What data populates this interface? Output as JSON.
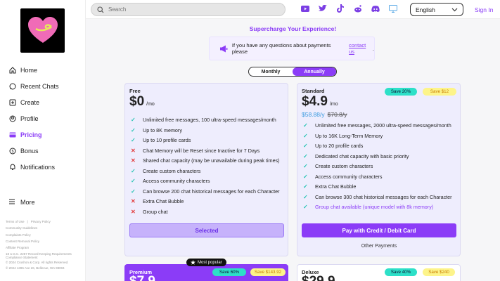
{
  "sidebar": {
    "items": [
      {
        "label": "Home",
        "icon": "home-icon"
      },
      {
        "label": "Recent Chats",
        "icon": "chat-icon"
      },
      {
        "label": "Create",
        "icon": "plus-square-icon"
      },
      {
        "label": "Profile",
        "icon": "user-icon"
      },
      {
        "label": "Pricing",
        "icon": "card-icon",
        "active": true
      },
      {
        "label": "Bonus",
        "icon": "coin-icon"
      },
      {
        "label": "Notifications",
        "icon": "bell-icon"
      }
    ],
    "more_label": "More",
    "footer": {
      "terms": "Terms of Use",
      "privacy": "Privacy Policy",
      "guidelines": "Community Guidelines",
      "complaints": "Complaints Policy",
      "content_removal": "Content Removal Policy",
      "affiliate": "Affiliate Program",
      "usc": "18 U.S.C. 2257 Record-Keeping Requirements Compliance Statement",
      "copyright": "© 2024 Crushon & Corp. All rights Reserved.",
      "address": "© 2024 1396 Ave 26, Bellevue, WA 98004"
    }
  },
  "topbar": {
    "search_placeholder": "Search",
    "socials": [
      "youtube-icon",
      "twitter-icon",
      "tiktok-icon",
      "reddit-icon",
      "discord-icon",
      "desktop-icon"
    ],
    "language": "English",
    "signin": "Sign In"
  },
  "main": {
    "headline": "Supercharge Your Experience!",
    "notice_text": "If you have any questions about payments please",
    "notice_link": "contact us",
    "notice_end": ".",
    "toggle": {
      "monthly": "Monthly",
      "annually": "Annually"
    }
  },
  "plans": {
    "free": {
      "name": "Free",
      "price": "$0",
      "per": "/mo",
      "features": [
        {
          "ok": true,
          "text": "Unlimited free messages, 100 ultra-speed messages/month"
        },
        {
          "ok": true,
          "text": "Up to 8K memory"
        },
        {
          "ok": true,
          "text": "Up to 10 profile cards"
        },
        {
          "ok": false,
          "text": "Chat Memory will be Reset since Inactive for 7 Days"
        },
        {
          "ok": false,
          "text": "Shared chat capacity (may be unavailable during peak times)"
        },
        {
          "ok": true,
          "text": "Create custom characters"
        },
        {
          "ok": true,
          "text": "Access community characters"
        },
        {
          "ok": true,
          "text": "Can browse 200 chat historical messages for each Character"
        },
        {
          "ok": false,
          "text": "Extra Chat Bubble"
        },
        {
          "ok": false,
          "text": "Group chat"
        }
      ],
      "button": "Selected"
    },
    "standard": {
      "name": "Standard",
      "price": "$4.9",
      "per": "/mo",
      "save_pct": "Save 20%",
      "save_amt": "Save $12",
      "yearly": "$58.88/y",
      "yearly_strike": "$70.8/y",
      "features": [
        {
          "ok": true,
          "text": "Unlimited free messages, 2000 ultra-speed messages/month"
        },
        {
          "ok": true,
          "text": "Up to 16K Long-Term Memory"
        },
        {
          "ok": true,
          "text": "Up to 20 profile cards"
        },
        {
          "ok": true,
          "text": "Dedicated chat capacity with basic priority"
        },
        {
          "ok": true,
          "text": "Create custom characters"
        },
        {
          "ok": true,
          "text": "Access community characters"
        },
        {
          "ok": true,
          "text": "Extra Chat Bubble"
        },
        {
          "ok": true,
          "text": "Can browse 300 chat historical messages for each Character"
        },
        {
          "ok": true,
          "text": "Group chat available (unique model with 8k memory)",
          "purple": true
        }
      ],
      "button": "Pay with Credit / Debit Card",
      "other": "Other Payments"
    },
    "premium": {
      "name": "Premium",
      "price": "$7.9",
      "popular": "Most popular",
      "save_pct": "Save 60%",
      "save_amt": "Save $143.92"
    },
    "deluxe": {
      "name": "Deluxe",
      "price": "$29.9",
      "save_pct": "Save 40%",
      "save_amt": "Save $240"
    }
  }
}
